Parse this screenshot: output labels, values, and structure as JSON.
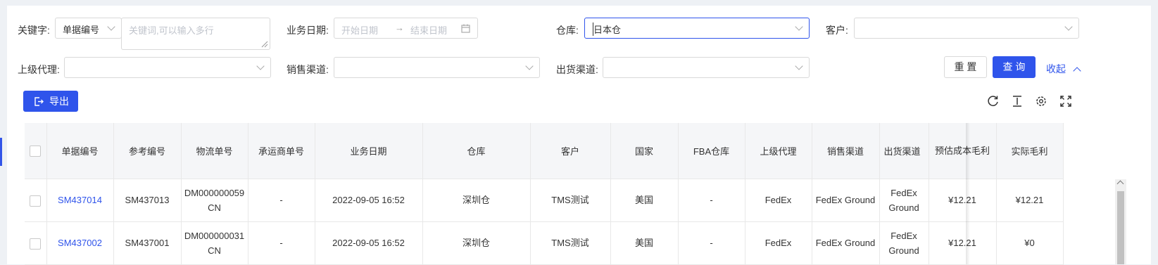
{
  "filters": {
    "keyword_label": "关键字:",
    "keyword_type": "单据编号",
    "keyword_placeholder": "关键词,可以输入多行",
    "date_label": "业务日期:",
    "date_start_placeholder": "开始日期",
    "date_arrow": "→",
    "date_end_placeholder": "结束日期",
    "warehouse_label": "仓库:",
    "warehouse_value": "日本仓",
    "customer_label": "客户:",
    "customer_value": "",
    "agent_label": "上级代理:",
    "agent_value": "",
    "sales_channel_label": "销售渠道:",
    "sales_channel_value": "",
    "ship_channel_label": "出货渠道:",
    "ship_channel_value": ""
  },
  "actions": {
    "reset_label": "重 置",
    "query_label": "查 询",
    "collapse_label": "收起",
    "export_label": "导出"
  },
  "table": {
    "columns": [
      "单据编号",
      "参考编号",
      "物流单号",
      "承运商单号",
      "业务日期",
      "仓库",
      "客户",
      "国家",
      "FBA仓库",
      "上级代理",
      "销售渠道",
      "出货渠道",
      "预估成本毛利",
      "实际毛利"
    ],
    "rows": [
      {
        "doc_no": "SM437014",
        "ref_no": "SM437013",
        "logistics_no": "DM000000059CN",
        "carrier_no": "-",
        "date": "2022-09-05 16:52",
        "warehouse": "深圳仓",
        "customer": "TMS测试",
        "country": "美国",
        "fba": "-",
        "agent": "FedEx",
        "sales_channel": "FedEx Ground",
        "ship_channel": "FedEx Ground",
        "est_profit": "¥12.21",
        "actual_profit": "¥12.21"
      },
      {
        "doc_no": "SM437002",
        "ref_no": "SM437001",
        "logistics_no": "DM000000031CN",
        "carrier_no": "-",
        "date": "2022-09-05 16:52",
        "warehouse": "深圳仓",
        "customer": "TMS测试",
        "country": "美国",
        "fba": "-",
        "agent": "FedEx",
        "sales_channel": "FedEx Ground",
        "ship_channel": "FedEx Ground",
        "est_profit": "¥12.21",
        "actual_profit": "¥0"
      }
    ]
  }
}
